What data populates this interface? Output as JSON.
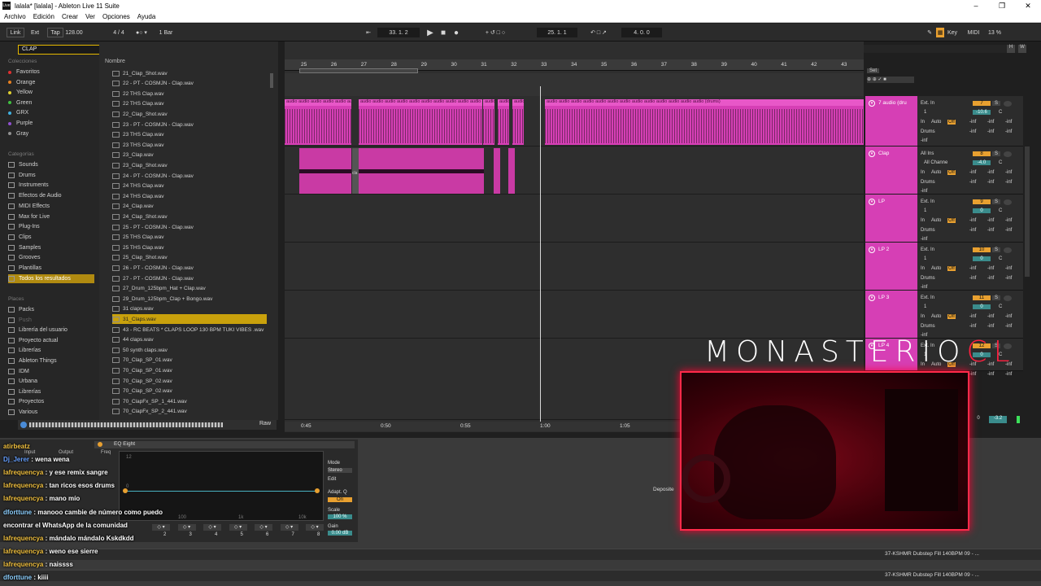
{
  "window": {
    "title": "lalala*  [lalala] - Ableton Live 11 Suite",
    "logo": "Live"
  },
  "menu": [
    "Archivo",
    "Edición",
    "Crear",
    "Ver",
    "Opciones",
    "Ayuda"
  ],
  "transport": {
    "link": "Link",
    "ext": "Ext",
    "tap": "Tap",
    "bpm": "128.00",
    "signature": "4 / 4",
    "quantize": "1 Bar",
    "position": "33.   1.   2",
    "loop_start": "25.   1.   1",
    "loop_length": "4.   0.   0",
    "key": "Key",
    "midi": "MIDI",
    "cpu": "13 %"
  },
  "search": {
    "value": "CLAP"
  },
  "collections": {
    "header": "Colecciones",
    "items": [
      {
        "label": "Favoritos",
        "color": "#e03030"
      },
      {
        "label": "Orange",
        "color": "#e88020"
      },
      {
        "label": "Yellow",
        "color": "#e0d030"
      },
      {
        "label": "Green",
        "color": "#40c040"
      },
      {
        "label": "GRX",
        "color": "#40b0e0"
      },
      {
        "label": "Purple",
        "color": "#9050d0"
      },
      {
        "label": "Gray",
        "color": "#909090"
      }
    ]
  },
  "categories": {
    "header": "Categorías",
    "items": [
      "Sounds",
      "Drums",
      "Instruments",
      "Efectos de Audio",
      "MIDI Effects",
      "Max for Live",
      "Plug-Ins",
      "Clips",
      "Samples",
      "Grooves",
      "Plantillas",
      "Todos los resultados"
    ]
  },
  "places": {
    "header": "Places",
    "items": [
      "Packs",
      "Push",
      "Librería del usuario",
      "Proyecto actual",
      "Librerías",
      "Ableton Things",
      "IDM",
      "Urbana",
      "Librerías",
      "Proyectos",
      "Various"
    ]
  },
  "files": {
    "header": "Nombre",
    "selected_index": 23,
    "items": [
      "21_Clap_Shot.wav",
      "22 - PT - COSMJN - Clap.wav",
      "22 THS Clap.wav",
      "22 THS Clap.wav",
      "22_Clap_Shot.wav",
      "23 - PT - COSMJN - Clap.wav",
      "23 THS Clap.wav",
      "23 THS Clap.wav",
      "23_Clap.wav",
      "23_Clap_Shot.wav",
      "24 - PT - COSMJN - Clap.wav",
      "24 THS Clap.wav",
      "24 THS Clap.wav",
      "24_Clap.wav",
      "24_Clap_Shot.wav",
      "25 - PT - COSMJN - Clap.wav",
      "25 THS Clap.wav",
      "25 THS Clap.wav",
      "25_Clap_Shot.wav",
      "26 - PT - COSMJN - Clap.wav",
      "27 - PT - COSMJN - Clap.wav",
      "27_Drum_125bpm_Hat + Clap.wav",
      "29_Drum_125bpm_Clap + Bongo.wav",
      "31 claps.wav",
      "31_Claps.wav",
      "43 - RC BEATS * CLAPS LOOP 130 BPM TUKI VIBES .wav",
      "44 claps.wav",
      "50 synth claps.wav",
      "70_Clap_SP_01.wav",
      "70_Clap_SP_01.wav",
      "70_Clap_SP_02.wav",
      "70_Clap_SP_02.wav",
      "70_ClapFx_SP_1_441.wav",
      "70_ClapFx_SP_2_441.wav"
    ],
    "raw": "Raw"
  },
  "ruler": [
    "25",
    "26",
    "27",
    "28",
    "29",
    "30",
    "31",
    "32",
    "33",
    "34",
    "35",
    "36",
    "37",
    "38",
    "39",
    "40",
    "41",
    "42",
    "43"
  ],
  "time_ruler": [
    "0:45",
    "0:50",
    "0:55",
    "1:00",
    "1:05"
  ],
  "set_label": "Set",
  "tracks": [
    {
      "name": "7 audio (dru",
      "input": "Ext. In",
      "channel": "1",
      "out": "Drums",
      "num": "7",
      "vol": "-10.6",
      "pan": "C"
    },
    {
      "name": "Clap",
      "input": "All Ins",
      "channel": "All Channe",
      "out": "Drums",
      "num": "8",
      "vol": "-4.0",
      "pan": "C"
    },
    {
      "name": "LP",
      "input": "Ext. In",
      "channel": "1",
      "out": "Drums",
      "num": "9",
      "vol": "0",
      "pan": "C"
    },
    {
      "name": "LP 2",
      "input": "Ext. In",
      "channel": "1",
      "out": "Drums",
      "num": "10",
      "vol": "0",
      "pan": "C"
    },
    {
      "name": "LP 3",
      "input": "Ext. In",
      "channel": "1",
      "out": "Drums",
      "num": "11",
      "vol": "0",
      "pan": "C"
    },
    {
      "name": "LP 4",
      "input": "Ext. In",
      "channel": "1",
      "out": "Drums",
      "num": "12",
      "vol": "0",
      "pan": "C"
    }
  ],
  "monitor": {
    "in": "In",
    "auto": "Auto",
    "off": "Off",
    "inf": "-inf",
    "s": "S"
  },
  "clips": {
    "audio_label": "audio audio audio audio audio audio audio audio audio audio audio audio audio (drums)",
    "clap_label": "cla"
  },
  "devices": {
    "eq_title": "EQ Eight",
    "mode": "Mode",
    "stereo": "Stereo",
    "edit": "Edit",
    "adapt_q": "Adapt. Q",
    "on": "On",
    "scale": "Scale",
    "scale_val": "100 %",
    "gain": "Gain",
    "gain_val": "0.00 dB",
    "freq": "Freq",
    "input": "Input",
    "output": "Output",
    "grid": [
      "12",
      "0",
      "-12",
      "100",
      "1k",
      "10k"
    ],
    "bands": [
      "2",
      "3",
      "4",
      "5",
      "6",
      "7",
      "8"
    ]
  },
  "chat": [
    {
      "user": "atirbeatz",
      "msg": "",
      "color": "u"
    },
    {
      "user": "Dj_Jerer",
      "msg": "wena wena",
      "color": "u2"
    },
    {
      "user": "lafrequencya",
      "msg": "y ese remix sangre",
      "color": "u"
    },
    {
      "user": "lafrequencya",
      "msg": "tan ricos esos drums",
      "color": "u"
    },
    {
      "user": "lafrequencya",
      "msg": "mano mío",
      "color": "u"
    },
    {
      "user": "dforttune",
      "msg": "manooo cambie de número como puedo",
      "color": "u3"
    },
    {
      "user": "",
      "msg": "encontrar el WhatsApp de la comunidad",
      "color": "u"
    },
    {
      "user": "lafrequencya",
      "msg": "mándalo mándalo Kskdkdd",
      "color": "u"
    },
    {
      "user": "lafrequencya",
      "msg": "weno ese sierre",
      "color": "u"
    },
    {
      "user": "lafrequencya",
      "msg": "naissss",
      "color": "u"
    },
    {
      "user": "dforttune",
      "msg": "kiiii",
      "color": "u3"
    }
  ],
  "overlay": {
    "title_a": "MONASTERIO",
    "title_b": "CL",
    "deposite": "Deposite"
  },
  "bottom_clips": [
    "37-KSHMR Dubstep Fill 140BPM 09 - ...",
    "37-KSHMR Dubstep Fill 140BPM 09 - ..."
  ],
  "master": {
    "vol": "-3.2",
    "zero": "0"
  }
}
